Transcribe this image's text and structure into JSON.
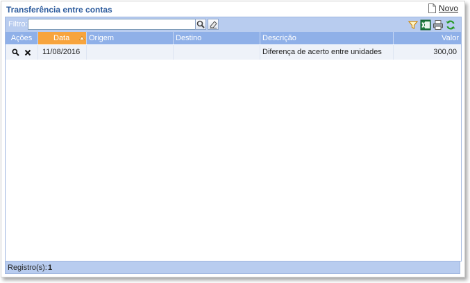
{
  "page": {
    "title": "Transferência entre contas",
    "new_label": "Novo"
  },
  "toolbar": {
    "filter_label": "Filtro:",
    "filter_value": "",
    "icons": [
      "search-icon",
      "clear-icon",
      "filter-icon",
      "excel-icon",
      "print-icon",
      "refresh-icon"
    ]
  },
  "grid": {
    "columns": [
      "Ações",
      "Data",
      "Origem",
      "Destino",
      "Descrição",
      "Valor"
    ],
    "sorted_column": "Data",
    "rows": [
      {
        "actions": [
          "view-icon",
          "delete-icon"
        ],
        "data": "11/08/2016",
        "origem": "",
        "destino": "",
        "descricao": "Diferença de acerto entre unidades",
        "valor": "300,00"
      }
    ]
  },
  "footer": {
    "label": "Registro(s):",
    "count": "1"
  },
  "colors": {
    "title": "#2b5a9c",
    "header": "#8fb0e8",
    "sorted_header": "#f7a43d",
    "toolbar": "#b8ccef"
  }
}
